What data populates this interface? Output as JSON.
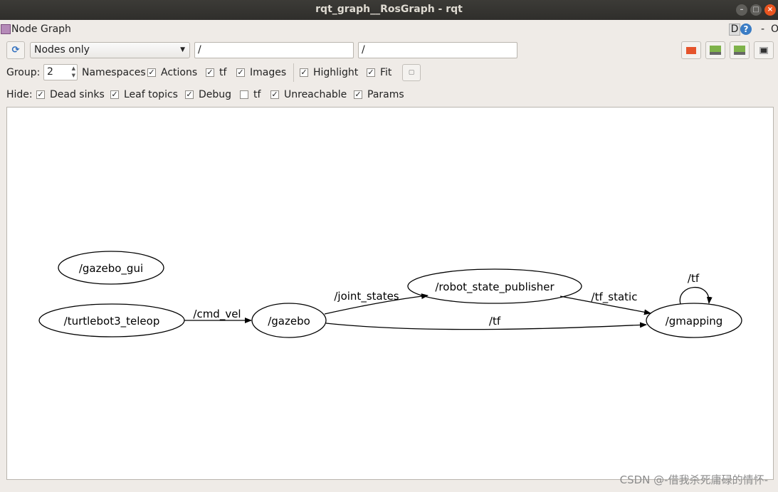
{
  "window": {
    "title": "rqt_graph__RosGraph - rqt",
    "buttons": [
      "minimize",
      "maximize",
      "close"
    ]
  },
  "plugin": {
    "title": "Node Graph",
    "d_label": "D",
    "help_label": "?",
    "dash": "-",
    "o_label": "O"
  },
  "toolbar": {
    "refresh_icon": "refresh-icon",
    "mode": "Nodes only",
    "filter1": "/",
    "filter2": "/",
    "icons": [
      "open-folder-icon",
      "save-dot-icon",
      "save-image-icon",
      "fit-screen-icon"
    ]
  },
  "row2": {
    "group_label": "Group:",
    "group_value": "2",
    "items": [
      {
        "label": "Namespaces",
        "checked": null
      },
      {
        "label": "Actions",
        "checked": true
      },
      {
        "label": "tf",
        "checked": true
      },
      {
        "label": "Images",
        "checked": true
      },
      {
        "label": "Highlight",
        "checked": true
      },
      {
        "label": "Fit",
        "checked": true
      }
    ]
  },
  "row3": {
    "hide_label": "Hide:",
    "items": [
      {
        "label": "Dead sinks",
        "checked": true
      },
      {
        "label": "Leaf topics",
        "checked": true
      },
      {
        "label": "Debug",
        "checked": true
      },
      {
        "label": "tf",
        "checked": false
      },
      {
        "label": "Unreachable",
        "checked": true
      },
      {
        "label": "Params",
        "checked": true
      }
    ]
  },
  "graph": {
    "nodes": [
      "/gazebo_gui",
      "/turtlebot3_teleop",
      "/gazebo",
      "/robot_state_publisher",
      "/gmapping"
    ],
    "edges": [
      {
        "from": "/turtlebot3_teleop",
        "to": "/gazebo",
        "topic": "/cmd_vel"
      },
      {
        "from": "/gazebo",
        "to": "/robot_state_publisher",
        "topic": "/joint_states"
      },
      {
        "from": "/gazebo",
        "to": "/gmapping",
        "topic": "/tf"
      },
      {
        "from": "/robot_state_publisher",
        "to": "/gmapping",
        "topic": "/tf_static"
      },
      {
        "from": "/gmapping",
        "to": "/gmapping",
        "topic": "/tf"
      }
    ]
  },
  "watermark": "CSDN @-借我杀死庸碌的情怀-"
}
